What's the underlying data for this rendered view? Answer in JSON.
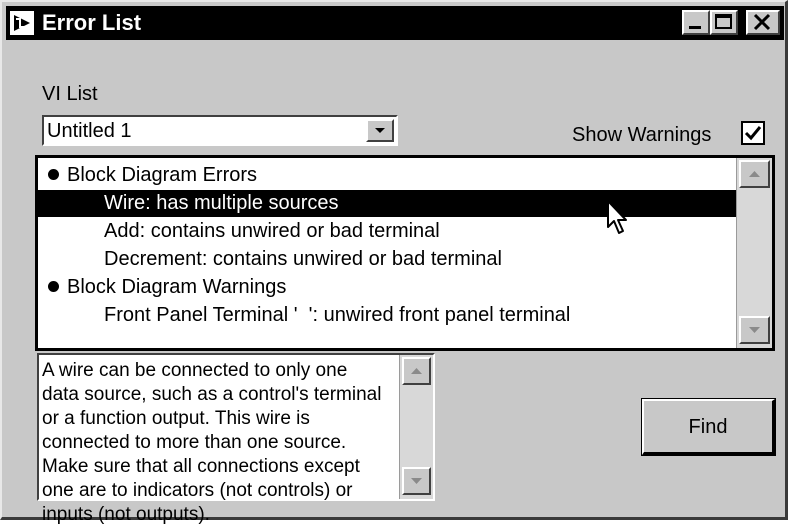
{
  "window": {
    "title": "Error List",
    "controls": {
      "minimize": "minimize-icon",
      "maximize": "maximize-icon",
      "close": "close-icon"
    }
  },
  "vi_list": {
    "label": "VI List",
    "selected": "Untitled 1"
  },
  "show_warnings": {
    "label": "Show Warnings",
    "checked": true
  },
  "error_list": {
    "items": [
      {
        "text": "Block Diagram Errors",
        "type": "header",
        "selected": false
      },
      {
        "text": "Wire: has multiple sources",
        "type": "item",
        "selected": true
      },
      {
        "text": "Add: contains unwired or bad terminal",
        "type": "item",
        "selected": false
      },
      {
        "text": "Decrement: contains unwired or bad terminal",
        "type": "item",
        "selected": false
      },
      {
        "text": "Block Diagram Warnings",
        "type": "header",
        "selected": false
      },
      {
        "text": "Front Panel Terminal '  ': unwired front panel terminal",
        "type": "item",
        "selected": false
      }
    ]
  },
  "description": "A wire can be connected to only one data source, such as a control's terminal or a function output. This wire is connected to more than one source. Make sure that all connections except one are to indicators (not controls) or inputs (not outputs).",
  "find_button": {
    "label": "Find"
  },
  "colors": {
    "selection": "#000000",
    "face": "#c8c8c8",
    "title_bar": "#000000"
  }
}
